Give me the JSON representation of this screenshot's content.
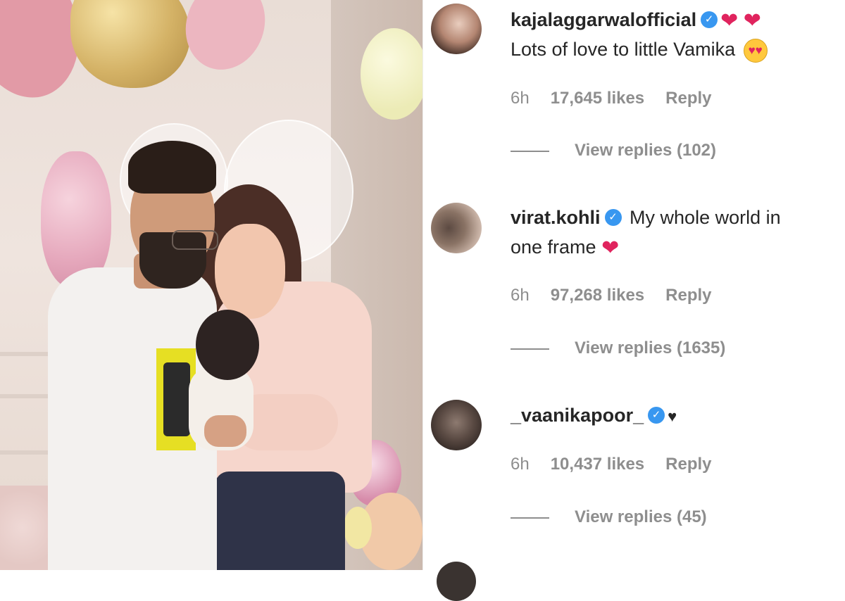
{
  "photo": {
    "alt_subject": "couple-with-baby"
  },
  "comments": [
    {
      "username": "kajalaggarwalofficial",
      "verified": true,
      "line1_suffix": "",
      "text": "Lots of love to little Vamika",
      "time": "6h",
      "likes": "17,645 likes",
      "reply": "Reply",
      "view_replies": "View replies (102)"
    },
    {
      "username": "virat.kohli",
      "verified": true,
      "line1_suffix": "My whole world in",
      "text": "one frame",
      "time": "6h",
      "likes": "97,268 likes",
      "reply": "Reply",
      "view_replies": "View replies (1635)"
    },
    {
      "username": "_vaanikapoor_",
      "verified": true,
      "line1_suffix": "",
      "text": "",
      "time": "6h",
      "likes": "10,437 likes",
      "reply": "Reply",
      "view_replies": "View replies (45)"
    }
  ],
  "colors": {
    "verified_badge": "#3897f0",
    "heart": "#e0245e",
    "meta_text": "#8e8e8e",
    "primary_text": "#262626"
  },
  "icons": {
    "verified": "verified-badge-icon",
    "heart_red": "red-heart-emoji",
    "heart_black": "black-heart-emoji",
    "heart_eyes": "heart-eyes-emoji"
  }
}
